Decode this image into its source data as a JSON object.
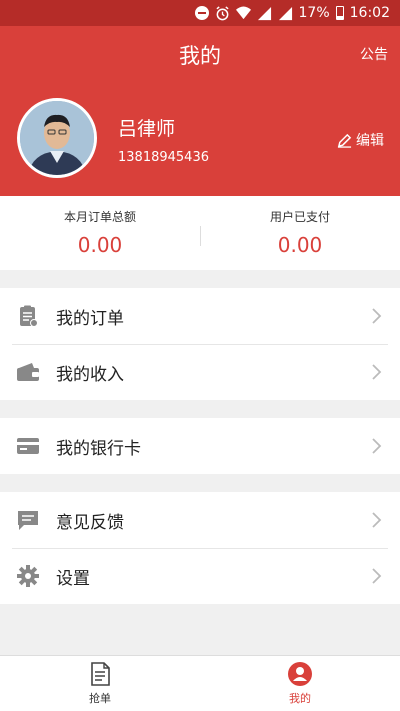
{
  "status_bar": {
    "battery": "17%",
    "time": "16:02"
  },
  "header": {
    "title": "我的",
    "notice_label": "公告"
  },
  "profile": {
    "name": "吕律师",
    "phone": "13818945436",
    "edit_label": "编辑"
  },
  "stats": [
    {
      "label": "本月订单总额",
      "value": "0.00"
    },
    {
      "label": "用户已支付",
      "value": "0.00"
    }
  ],
  "menu": {
    "orders": "我的订单",
    "income": "我的收入",
    "bank_card": "我的银行卡",
    "feedback": "意见反馈",
    "settings": "设置"
  },
  "tabbar": {
    "grab": "抢单",
    "mine": "我的"
  },
  "colors": {
    "accent": "#d9403a",
    "status_bar": "#b52c28"
  }
}
